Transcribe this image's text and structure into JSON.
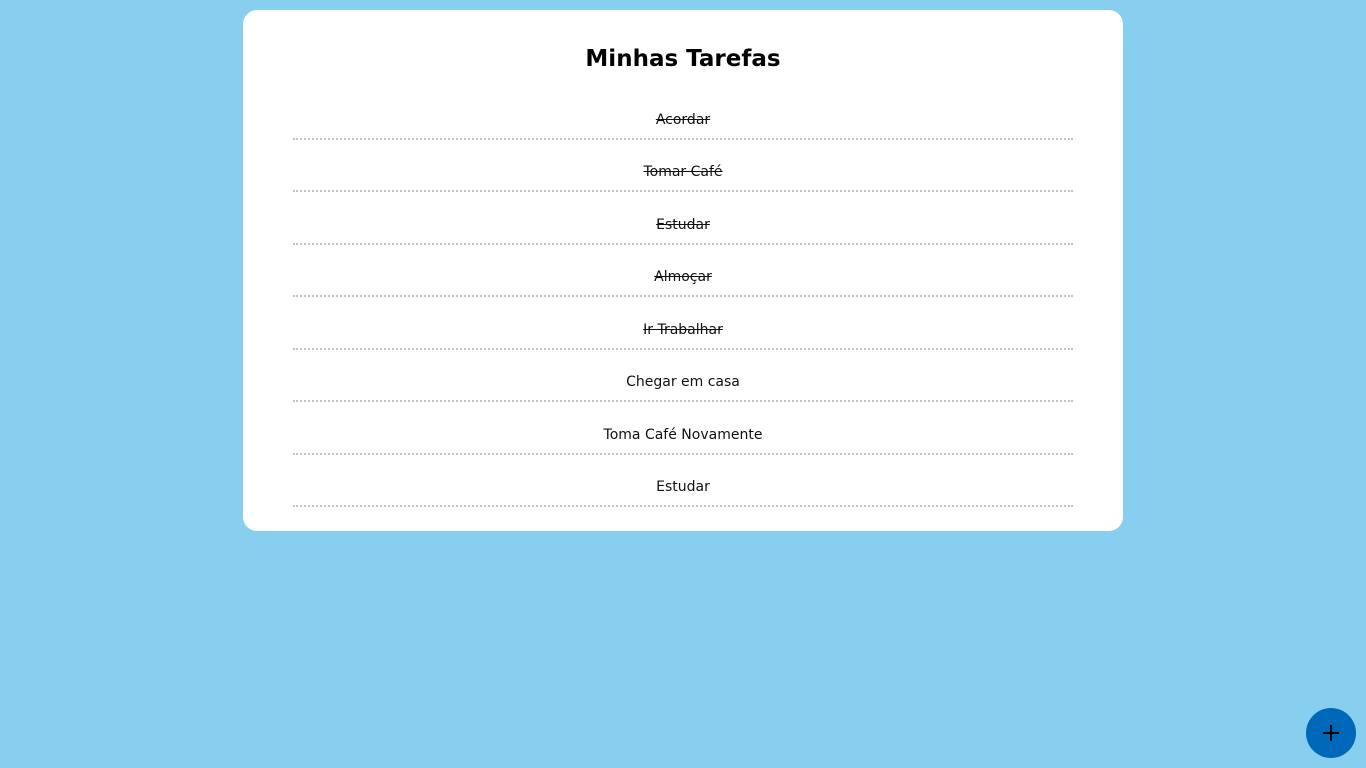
{
  "page": {
    "title": "Minhas Tarefas"
  },
  "tasks": [
    {
      "label": "Acordar",
      "done": true
    },
    {
      "label": "Tomar Café",
      "done": true
    },
    {
      "label": "Estudar",
      "done": true
    },
    {
      "label": "Almoçar",
      "done": true
    },
    {
      "label": "Ir Trabalhar",
      "done": true
    },
    {
      "label": "Chegar em casa",
      "done": false
    },
    {
      "label": "Toma Café Novamente",
      "done": false
    },
    {
      "label": "Estudar",
      "done": false
    }
  ],
  "add_button": {
    "icon": "plus-icon"
  },
  "colors": {
    "background": "#87CEEF",
    "card": "#ffffff",
    "accent": "#0068B8"
  }
}
